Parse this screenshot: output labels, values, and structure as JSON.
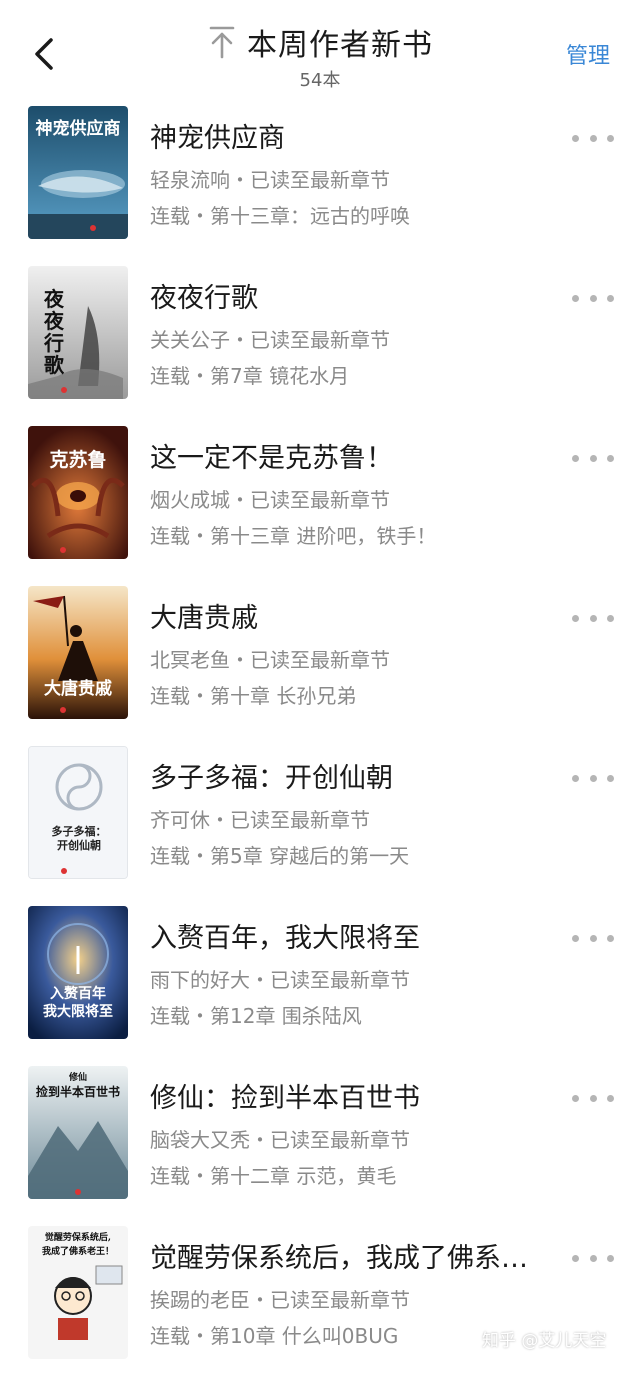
{
  "header": {
    "title": "本周作者新书",
    "subtitle": "54本",
    "manage_label": "管理"
  },
  "books": [
    {
      "title": "神宠供应商",
      "meta": "轻泉流响・已读至最新章节",
      "chapter": "连载・第十三章：远古的呼唤",
      "cover_title": "神宠供应商",
      "cover_colors": [
        "#1d4d6b",
        "#5aa0c8"
      ]
    },
    {
      "title": "夜夜行歌",
      "meta": "关关公子・已读至最新章节",
      "chapter": "连载・第7章 镜花水月",
      "cover_title": "夜夜行歌",
      "cover_colors": [
        "#e9e9e9",
        "#9a9a9a"
      ]
    },
    {
      "title": "这一定不是克苏鲁！",
      "meta": "烟火成城・已读至最新章节",
      "chapter": "连载・第十三章 进阶吧，铁手！",
      "cover_title": "克苏鲁",
      "cover_colors": [
        "#5a1a12",
        "#c0542a"
      ]
    },
    {
      "title": "大唐贵戚",
      "meta": "北冥老鱼・已读至最新章节",
      "chapter": "连载・第十章 长孙兄弟",
      "cover_title": "大唐贵戚",
      "cover_colors": [
        "#2a1a10",
        "#e39a3a"
      ]
    },
    {
      "title": "多子多福：开创仙朝",
      "meta": "齐可休・已读至最新章节",
      "chapter": "连载・第5章 穿越后的第一天",
      "cover_title": "多子多福：开创仙朝",
      "cover_colors": [
        "#f3f5f8",
        "#c4ccd6"
      ]
    },
    {
      "title": "入赘百年，我大限将至",
      "meta": "雨下的好大・已读至最新章节",
      "chapter": "连载・第12章 围杀陆风",
      "cover_title": "入赘百年 我大限将至",
      "cover_colors": [
        "#0e2a5c",
        "#e0a04a"
      ]
    },
    {
      "title": "修仙：捡到半本百世书",
      "meta": "脑袋大又秃・已读至最新章节",
      "chapter": "连载・第十二章 示范，黄毛",
      "cover_title": "捡到半本百世书",
      "cover_colors": [
        "#dfe7ea",
        "#6d8a98"
      ]
    },
    {
      "title": "觉醒劳保系统后，我成了佛系…",
      "meta": "挨踢的老臣・已读至最新章节",
      "chapter": "连载・第10章 什么叫0BUG",
      "cover_title": "觉醒劳保系统后，我成了佛系老王！",
      "cover_colors": [
        "#f5f5f5",
        "#cfd6de"
      ]
    }
  ],
  "watermark": "知乎 @艾儿天空",
  "icons": {
    "back": "back-chevron-icon",
    "pin_top": "pin-to-top-icon",
    "more": "more-dots-icon"
  },
  "accent_color": "#3a87d6"
}
